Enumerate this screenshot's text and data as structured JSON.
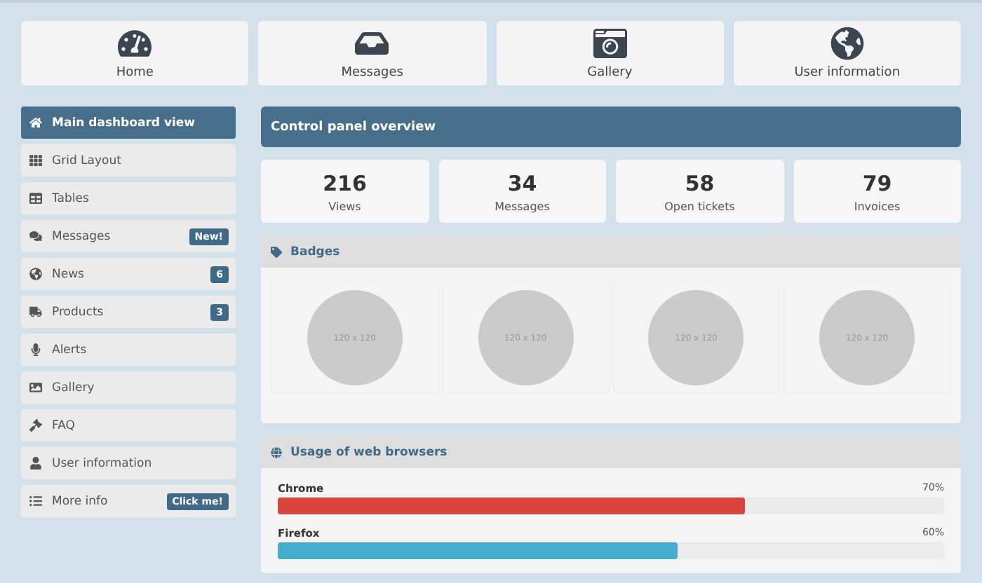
{
  "top_nav": [
    {
      "label": "Home"
    },
    {
      "label": "Messages"
    },
    {
      "label": "Gallery"
    },
    {
      "label": "User information"
    }
  ],
  "sidebar": {
    "items": [
      {
        "label": "Main dashboard view",
        "selected": true
      },
      {
        "label": "Grid Layout",
        "selected": false
      },
      {
        "label": "Tables",
        "selected": false
      },
      {
        "label": "Messages",
        "selected": false,
        "badge": "New!"
      },
      {
        "label": "News",
        "selected": false,
        "badge": "6"
      },
      {
        "label": "Products",
        "selected": false,
        "badge": "3"
      },
      {
        "label": "Alerts",
        "selected": false
      },
      {
        "label": "Gallery",
        "selected": false
      },
      {
        "label": "FAQ",
        "selected": false
      },
      {
        "label": "User information",
        "selected": false
      },
      {
        "label": "More info",
        "selected": false,
        "badge": "Click me!"
      }
    ]
  },
  "header": {
    "title": "Control panel overview"
  },
  "stats": [
    {
      "value": "216",
      "label": "Views"
    },
    {
      "value": "34",
      "label": "Messages"
    },
    {
      "value": "58",
      "label": "Open tickets"
    },
    {
      "value": "79",
      "label": "Invoices"
    }
  ],
  "badges_panel": {
    "title": "Badges",
    "placeholders": [
      "120 x 120",
      "120 x 120",
      "120 x 120",
      "120 x 120"
    ]
  },
  "browsers_panel": {
    "title": "Usage of web browsers",
    "bars": [
      {
        "name": "Chrome",
        "reading": "70%",
        "level": 0.7,
        "color": "#d9443f"
      },
      {
        "name": "Firefox",
        "reading": "60%",
        "level": 0.6,
        "color": "#45aecf"
      }
    ]
  }
}
